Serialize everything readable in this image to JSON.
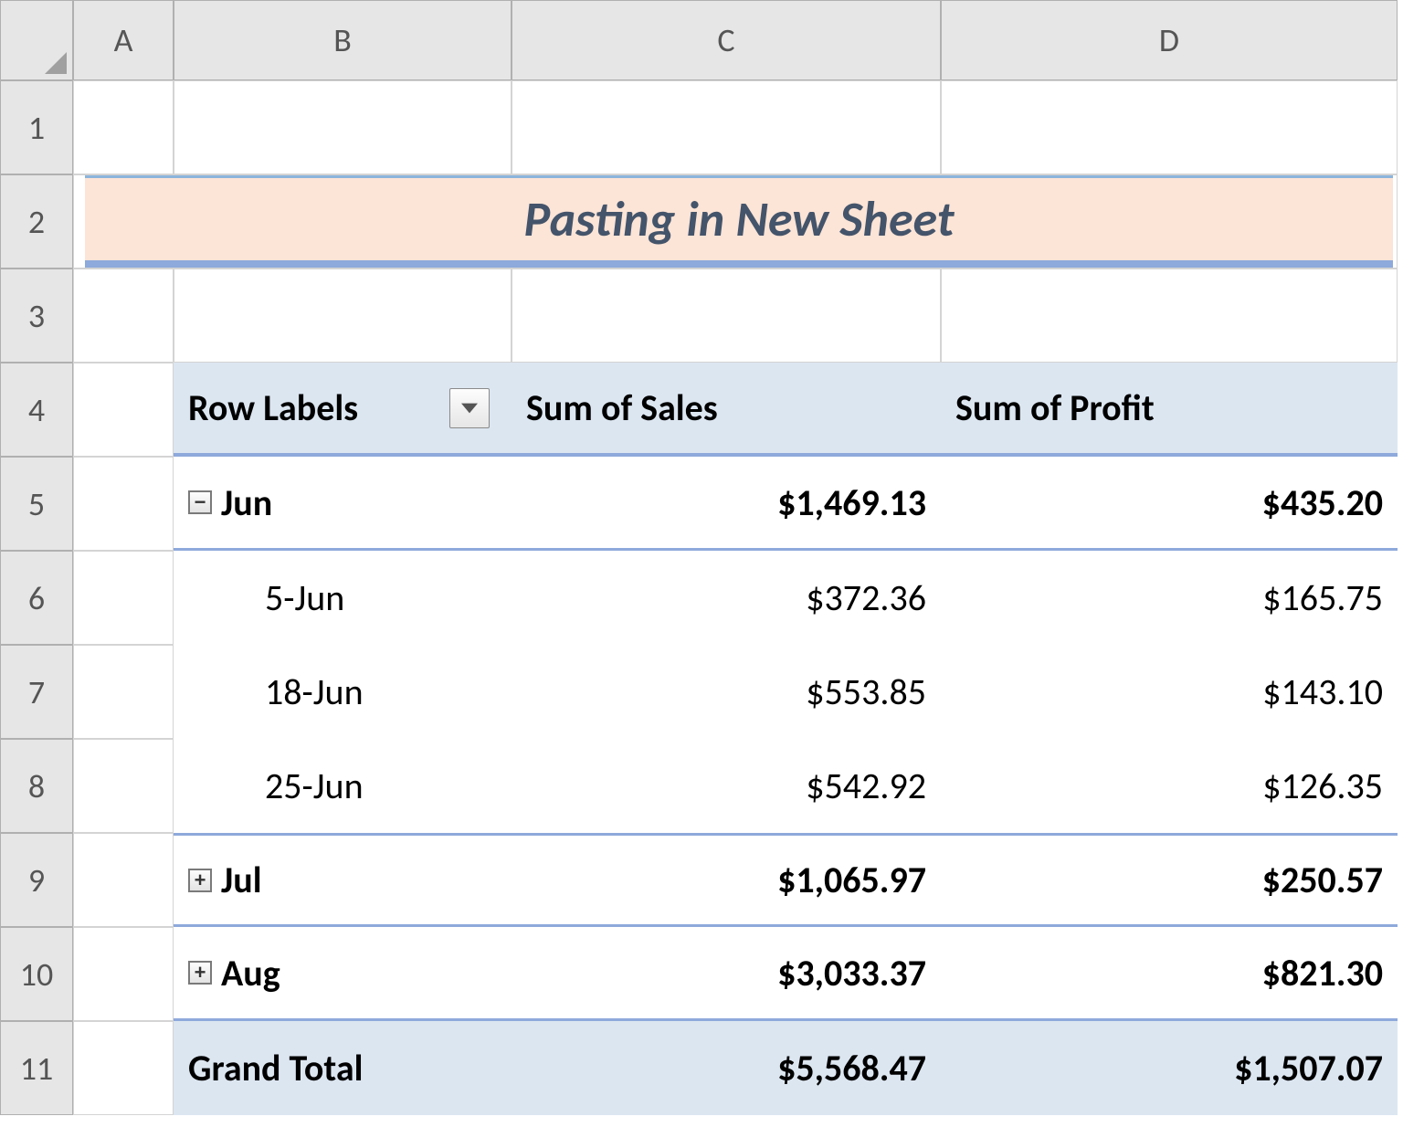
{
  "columns": [
    "A",
    "B",
    "C",
    "D"
  ],
  "rows": [
    "1",
    "2",
    "3",
    "4",
    "5",
    "6",
    "7",
    "8",
    "9",
    "10",
    "11"
  ],
  "title": "Pasting in New Sheet",
  "pivot": {
    "headers": {
      "row_labels": "Row Labels",
      "sum_sales": "Sum of Sales",
      "sum_profit": "Sum of Profit"
    },
    "rows": [
      {
        "type": "group",
        "expand": "minus",
        "label": "Jun",
        "sales": "$1,469.13",
        "profit": "$435.20"
      },
      {
        "type": "detail",
        "label": "5-Jun",
        "sales": "$372.36",
        "profit": "$165.75"
      },
      {
        "type": "detail",
        "label": "18-Jun",
        "sales": "$553.85",
        "profit": "$143.10"
      },
      {
        "type": "detail",
        "label": "25-Jun",
        "sales": "$542.92",
        "profit": "$126.35"
      },
      {
        "type": "group",
        "expand": "plus",
        "label": "Jul",
        "sales": "$1,065.97",
        "profit": "$250.57"
      },
      {
        "type": "group",
        "expand": "plus",
        "label": "Aug",
        "sales": "$3,033.37",
        "profit": "$821.30"
      }
    ],
    "grand_total": {
      "label": "Grand Total",
      "sales": "$5,568.47",
      "profit": "$1,507.07"
    }
  },
  "icons": {
    "minus": "−",
    "plus": "+"
  }
}
